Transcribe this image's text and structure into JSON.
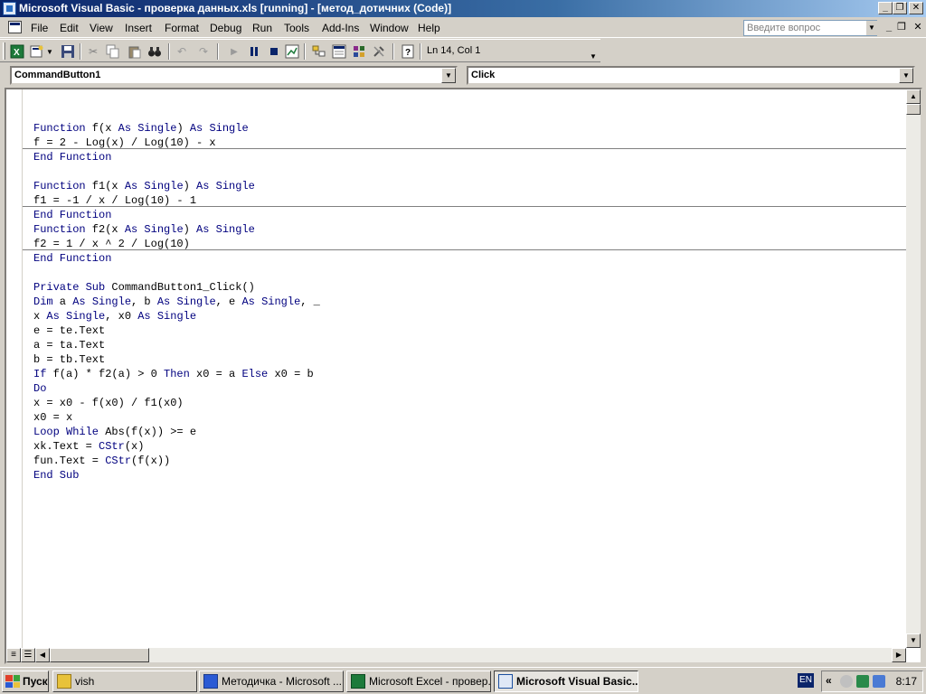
{
  "window": {
    "title": "Microsoft Visual Basic - проверка данных.xls [running] - [метод_дотичних (Code)]"
  },
  "menu": {
    "items": [
      "File",
      "Edit",
      "View",
      "Insert",
      "Format",
      "Debug",
      "Run",
      "Tools",
      "Add-Ins",
      "Window",
      "Help"
    ],
    "help_placeholder": "Введите вопрос"
  },
  "toolbar": {
    "position": "Ln 14, Col 1"
  },
  "combos": {
    "object": "CommandButton1",
    "procedure": "Click"
  },
  "code": {
    "procedures": [
      {
        "lines": [
          [
            [
              "kw",
              "Function"
            ],
            [
              "t",
              " f(x "
            ],
            [
              "kw",
              "As Single"
            ],
            [
              "t",
              ") "
            ],
            [
              "kw",
              "As Single"
            ]
          ],
          [
            [
              "t",
              "f = 2 - Log(x) / Log(10) - x"
            ]
          ],
          [
            [
              "kw",
              "End Function"
            ]
          ]
        ]
      },
      {
        "lines": [
          [
            [
              "kw",
              "Function"
            ],
            [
              "t",
              " f1(x "
            ],
            [
              "kw",
              "As Single"
            ],
            [
              "t",
              ") "
            ],
            [
              "kw",
              "As Single"
            ]
          ],
          [
            [
              "t",
              "f1 = -1 / x / Log(10) - 1"
            ]
          ],
          [
            [
              "kw",
              "End Function"
            ]
          ]
        ]
      },
      {
        "lines": [
          [
            [
              "kw",
              "Function"
            ],
            [
              "t",
              " f2(x "
            ],
            [
              "kw",
              "As Single"
            ],
            [
              "t",
              ") "
            ],
            [
              "kw",
              "As Single"
            ]
          ],
          [
            [
              "t",
              "f2 = 1 / x ^ 2 / Log(10)"
            ]
          ],
          [
            [
              "kw",
              "End Function"
            ]
          ]
        ]
      },
      {
        "lines": [
          [
            [
              "kw",
              "Private Sub"
            ],
            [
              "t",
              " CommandButton1_Click()"
            ]
          ],
          [
            [
              "kw",
              "Dim"
            ],
            [
              "t",
              " a "
            ],
            [
              "kw",
              "As Single"
            ],
            [
              "t",
              ", b "
            ],
            [
              "kw",
              "As Single"
            ],
            [
              "t",
              ", e "
            ],
            [
              "kw",
              "As Single"
            ],
            [
              "t",
              ", _"
            ]
          ],
          [
            [
              "t",
              "x "
            ],
            [
              "kw",
              "As Single"
            ],
            [
              "t",
              ", x0 "
            ],
            [
              "kw",
              "As Single"
            ]
          ],
          [
            [
              "t",
              "e = te.Text"
            ]
          ],
          [
            [
              "t",
              "a = ta.Text"
            ]
          ],
          [
            [
              "t",
              "b = tb.Text"
            ]
          ],
          [
            [
              "kw",
              "If"
            ],
            [
              "t",
              " f(a) * f2(a) > 0 "
            ],
            [
              "kw",
              "Then"
            ],
            [
              "t",
              " x0 = a "
            ],
            [
              "kw",
              "Else"
            ],
            [
              "t",
              " x0 = b"
            ]
          ],
          [
            [
              "kw",
              "Do"
            ]
          ],
          [
            [
              "t",
              "x = x0 - f(x0) / f1(x0)"
            ]
          ],
          [
            [
              "t",
              "x0 = x"
            ]
          ],
          [
            [
              "kw",
              "Loop While"
            ],
            [
              "t",
              " Abs(f(x)) >= e"
            ]
          ],
          [
            [
              "t",
              "xk.Text = "
            ],
            [
              "kw",
              "CStr"
            ],
            [
              "t",
              "(x)"
            ]
          ],
          [
            [
              "t",
              "fun.Text = "
            ],
            [
              "kw",
              "CStr"
            ],
            [
              "t",
              "(f(x))"
            ]
          ],
          [
            [
              "kw",
              "End Sub"
            ]
          ]
        ]
      }
    ]
  },
  "taskbar": {
    "start": "Пуск",
    "tasks": [
      {
        "label": "vish",
        "icon": "folder-icon"
      },
      {
        "label": "Методичка - Microsoft ...",
        "icon": "word-icon"
      },
      {
        "label": "Microsoft Excel - провер...",
        "icon": "excel-icon"
      },
      {
        "label": "Microsoft Visual Basic...",
        "icon": "vba-icon"
      }
    ],
    "lang": "EN",
    "clock": "8:17"
  }
}
